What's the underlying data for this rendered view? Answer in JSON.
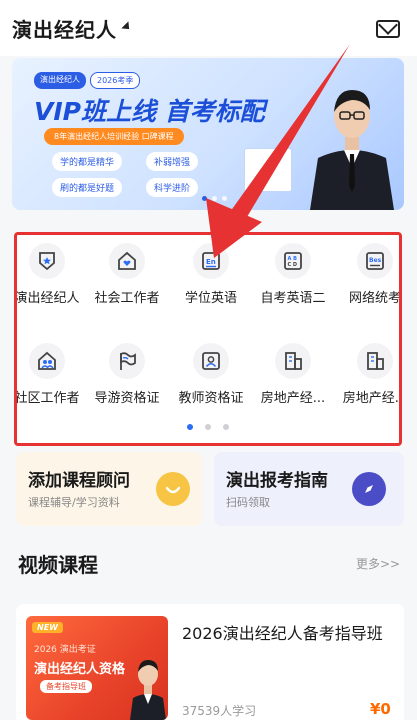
{
  "header": {
    "title": "演出经纪人"
  },
  "banner": {
    "tags": [
      "演出经纪人",
      "2026考季"
    ],
    "headline": "VIP班上线  首考标配",
    "subpill": "8年演出经纪人培训经验 口碑课程",
    "chips": [
      "学的都是精华",
      "补弱增强",
      "刷的都是好题",
      "科学进阶"
    ]
  },
  "categories": [
    {
      "label": "演出经纪人",
      "icon": "shield-star-icon"
    },
    {
      "label": "社会工作者",
      "icon": "heart-house-icon"
    },
    {
      "label": "学位英语",
      "icon": "english-book-icon"
    },
    {
      "label": "自考英语二",
      "icon": "abc-card-icon"
    },
    {
      "label": "网络统考",
      "icon": "bes-card-icon"
    },
    {
      "label": "社区工作者",
      "icon": "community-house-icon"
    },
    {
      "label": "导游资格证",
      "icon": "flag-icon"
    },
    {
      "label": "教师资格证",
      "icon": "teacher-id-icon"
    },
    {
      "label": "房地产经...",
      "icon": "building-icon"
    },
    {
      "label": "房地产经...",
      "icon": "building-icon"
    }
  ],
  "cards": [
    {
      "title": "添加课程顾问",
      "subtitle": "课程辅导/学习资料",
      "icon": "smile-icon",
      "color": "#f7c443"
    },
    {
      "title": "演出报考指南",
      "subtitle": "扫码领取",
      "icon": "compass-icon",
      "color": "#4b4dc7"
    }
  ],
  "section": {
    "title": "视频课程",
    "more": "更多>>"
  },
  "course": {
    "thumb_badge": "NEW",
    "thumb_line1": "2026 演出考证",
    "thumb_line2": "演出经纪人资格",
    "thumb_line3": "备考指导班",
    "title": "2026演出经纪人备考指导班",
    "learners": "37539人学习",
    "price": "¥0"
  },
  "colors": {
    "accent": "#2c6df5",
    "highlight_border": "#e63232",
    "price": "#ff6a00"
  }
}
